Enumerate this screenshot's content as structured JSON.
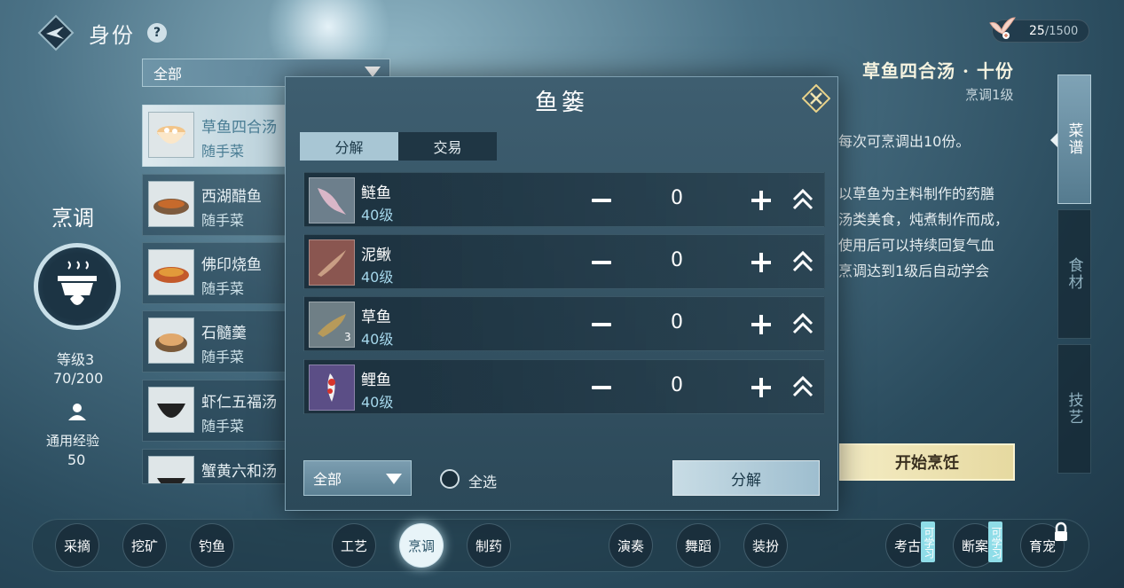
{
  "header": {
    "title": "身份",
    "help_icon": "question-icon"
  },
  "energy": {
    "current": "25",
    "max": "/1500",
    "icon": "bird-icon"
  },
  "category_dropdown": {
    "value": "全部"
  },
  "skill": {
    "name": "烹调",
    "level": "等级3",
    "exp": "70/200",
    "common_label": "通用经验",
    "common_value": "50",
    "icon": "cooking-pot-icon"
  },
  "recipes": [
    {
      "name": "草鱼四合汤",
      "sub": "随手菜",
      "active": true
    },
    {
      "name": "西湖醋鱼",
      "sub": "随手菜"
    },
    {
      "name": "佛印烧鱼",
      "sub": "随手菜"
    },
    {
      "name": "石髓羹",
      "sub": "随手菜"
    },
    {
      "name": "虾仁五福汤",
      "sub": "随手菜"
    },
    {
      "name": "蟹黄六和汤",
      "sub": ""
    }
  ],
  "dish": {
    "title": "草鱼四合汤 · 十份",
    "level": "烹调1级",
    "lines": [
      "每次可烹调出10份。",
      "以草鱼为主料制作的药膳",
      "汤类美食，炖煮制作而成，",
      "使用后可以持续回复气血",
      "烹调达到1级后自动学会"
    ],
    "start_button": "开始烹饪"
  },
  "side_tabs": [
    {
      "label": "菜谱",
      "active": true
    },
    {
      "label": "食材",
      "active": false
    },
    {
      "label": "技艺",
      "active": false
    }
  ],
  "modal": {
    "title": "鱼篓",
    "tabs": [
      "分解",
      "交易"
    ],
    "fish": [
      {
        "name": "鲢鱼",
        "level": "40级",
        "qty": "0",
        "count": "",
        "color": "#6d7f8c"
      },
      {
        "name": "泥鳅",
        "level": "40级",
        "qty": "0",
        "count": "",
        "color": "#8a5650"
      },
      {
        "name": "草鱼",
        "level": "40级",
        "qty": "0",
        "count": "3",
        "color": "#6f7f86"
      },
      {
        "name": "鲤鱼",
        "level": "40级",
        "qty": "0",
        "count": "",
        "color": "#5b4e86"
      }
    ],
    "filter_value": "全部",
    "select_all": "全选",
    "decompose_button": "分解"
  },
  "bottom_nav": [
    {
      "label": "采摘"
    },
    {
      "label": "挖矿"
    },
    {
      "label": "钓鱼"
    },
    {
      "label": "工艺"
    },
    {
      "label": "烹调",
      "active": true
    },
    {
      "label": "制药"
    },
    {
      "label": "演奏"
    },
    {
      "label": "舞蹈"
    },
    {
      "label": "装扮"
    },
    {
      "label": "考古"
    },
    {
      "label": "断案"
    },
    {
      "label": "育宠"
    }
  ],
  "learn_badge": "可学习"
}
